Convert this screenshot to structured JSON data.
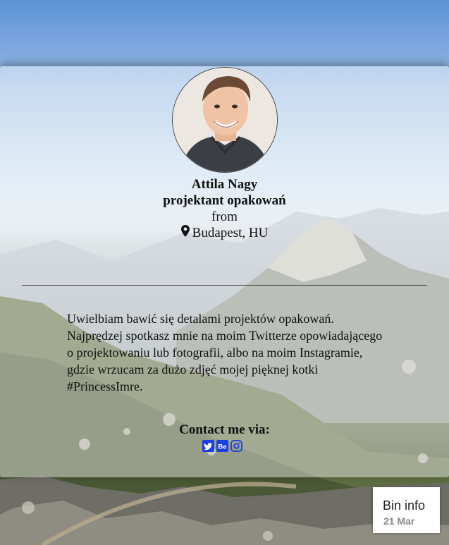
{
  "profile": {
    "name": "Attila Nagy",
    "title": "projektant opakowań",
    "from_label": "from",
    "location": "Budapest, HU"
  },
  "bio": "Uwielbiam bawić się detalami projektów opakowań. Najprędzej spotkasz mnie na moim Twitterze opowiadającego o projektowaniu lub fotografii, albo na moim Instagramie, gdzie wrzucam za dużo zdjęć mojej pięknej kotki #PrincessImre.",
  "contact": {
    "heading": "Contact me via:",
    "links": [
      {
        "icon": "twitter-icon"
      },
      {
        "icon": "behance-icon"
      },
      {
        "icon": "instagram-icon"
      }
    ]
  },
  "bin_info": {
    "title": "Bin info",
    "date": "21 Mar"
  },
  "colors": {
    "social_blue": "#1a3fe0",
    "sky": "#5d93d6",
    "card_overlay": "rgba(255,255,255,0.42)"
  }
}
